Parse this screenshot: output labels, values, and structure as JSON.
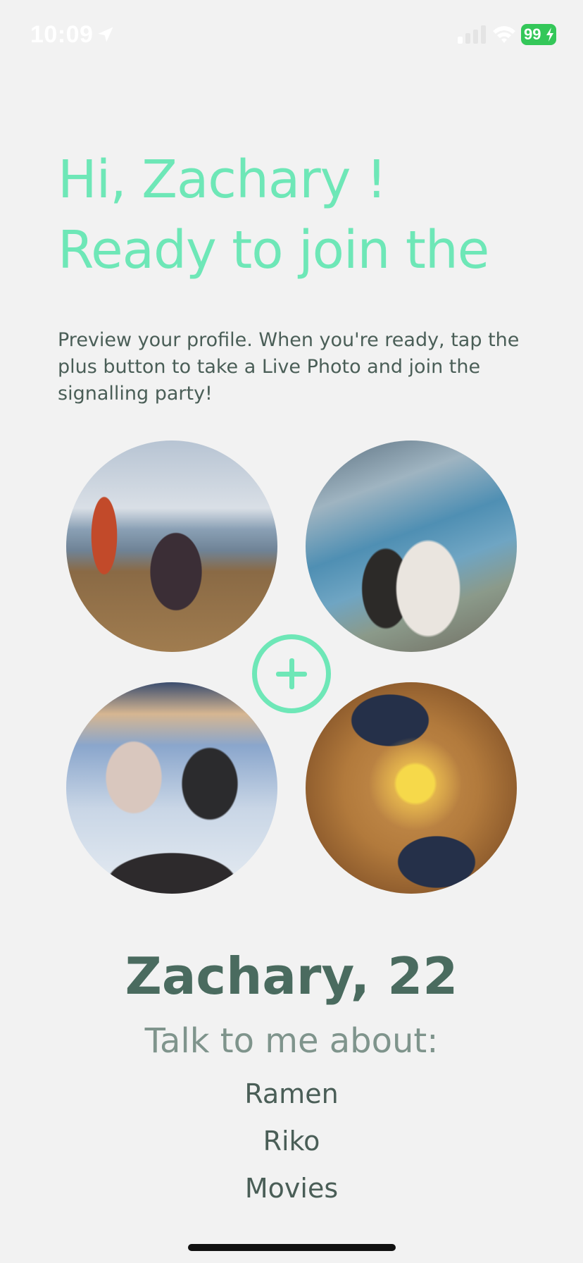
{
  "status_bar": {
    "time": "10:09",
    "battery": "99",
    "battery_color": "#34c759"
  },
  "greeting": {
    "line1": "Hi, Zachary !",
    "line2": "Ready to join the",
    "color": "#6ee7b7"
  },
  "description": "Preview your profile. When you're ready, tap the plus button to take a Live Photo and join the signalling party!",
  "photos": [
    {
      "name": "profile-photo-1"
    },
    {
      "name": "profile-photo-2"
    },
    {
      "name": "profile-photo-3"
    },
    {
      "name": "profile-photo-4"
    }
  ],
  "add_button": {
    "icon": "plus-icon"
  },
  "profile": {
    "name_age": "Zachary, 22",
    "talk_label": "Talk to me about:",
    "interests": [
      "Ramen",
      "Riko",
      "Movies"
    ]
  }
}
